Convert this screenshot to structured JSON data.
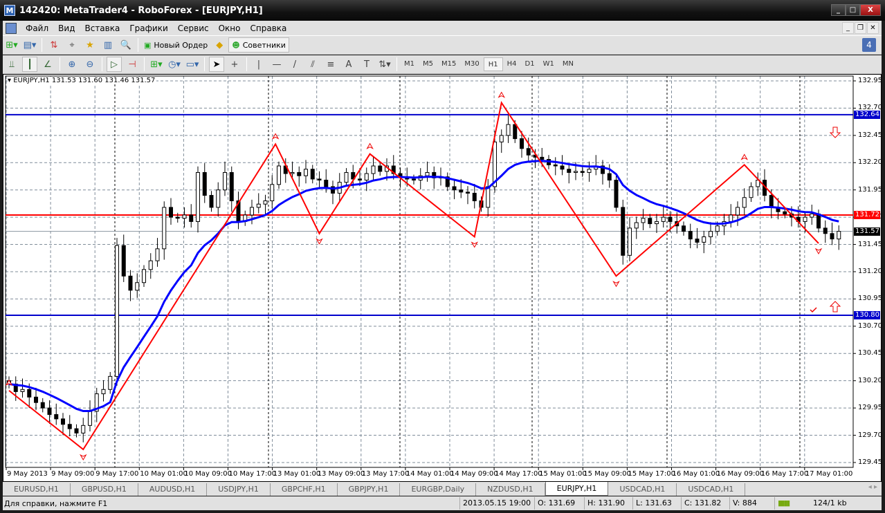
{
  "window": {
    "title": "142420: MetaTrader4 - RoboForex - [EURJPY,H1]",
    "minimize": "_",
    "maximize": "□",
    "close": "X"
  },
  "menu": [
    "Файл",
    "Вид",
    "Вставка",
    "Графики",
    "Сервис",
    "Окно",
    "Справка"
  ],
  "mdi": {
    "minimize": "_",
    "restore": "❐",
    "close": "✕"
  },
  "toolbar": {
    "new_order": "Новый Ордер",
    "experts": "Советники",
    "notifications": "4"
  },
  "timeframes": [
    "M1",
    "M5",
    "M15",
    "M30",
    "H1",
    "H4",
    "D1",
    "W1",
    "MN"
  ],
  "selected_timeframe": "H1",
  "chart_header": "EURJPY,H1  131.53 131.60 131.46 131.57",
  "chart_data": {
    "type": "candlestick",
    "symbol": "EURJPY",
    "timeframe": "H1",
    "ylim": [
      129.4,
      133.05
    ],
    "price_ticks": [
      "132.95",
      "132.70",
      "132.45",
      "132.20",
      "131.95",
      "131.70",
      "131.45",
      "131.20",
      "130.95",
      "130.70",
      "130.45",
      "130.20",
      "129.95",
      "129.70",
      "129.45"
    ],
    "time_ticks": [
      "9 May 2013",
      "9 May 09:00",
      "9 May 17:00",
      "10 May 01:00",
      "10 May 09:00",
      "10 May 17:00",
      "13 May 01:00",
      "13 May 09:00",
      "13 May 17:00",
      "14 May 01:00",
      "14 May 09:00",
      "14 May 17:00",
      "15 May 01:00",
      "15 May 09:00",
      "15 May 17:00",
      "16 May 01:00",
      "16 May 09:00",
      "16 May 17:00",
      "17 May 01:00"
    ],
    "close": [
      130.17,
      130.1,
      130.12,
      130.05,
      130.0,
      129.95,
      129.89,
      129.85,
      129.8,
      129.76,
      129.72,
      129.79,
      129.92,
      130.08,
      130.12,
      130.24,
      131.44,
      131.16,
      131.03,
      131.1,
      131.22,
      131.3,
      131.41,
      131.79,
      131.7,
      131.69,
      131.72,
      131.66,
      132.11,
      131.9,
      131.79,
      131.95,
      132.11,
      131.85,
      131.66,
      131.72,
      131.79,
      131.82,
      131.85,
      132.0,
      132.17,
      132.1,
      132.11,
      132.08,
      132.14,
      132.05,
      132.04,
      131.98,
      131.92,
      132.02,
      132.11,
      132.05,
      132.04,
      132.1,
      132.17,
      132.12,
      132.17,
      132.1,
      132.07,
      132.05,
      132.04,
      132.08,
      132.11,
      132.06,
      132.07,
      131.98,
      131.95,
      131.93,
      131.92,
      131.85,
      131.79,
      131.98,
      132.39,
      132.45,
      132.55,
      132.42,
      132.33,
      132.27,
      132.25,
      132.23,
      132.18,
      132.17,
      132.14,
      132.11,
      132.12,
      132.11,
      132.14,
      132.17,
      132.1,
      132.04,
      131.79,
      131.35,
      131.6,
      131.65,
      131.69,
      131.64,
      131.66,
      131.7,
      131.66,
      131.62,
      131.57,
      131.5,
      131.47,
      131.52,
      131.57,
      131.62,
      131.66,
      131.72,
      131.79,
      131.88,
      131.98,
      132.04,
      131.9,
      131.79,
      131.75,
      131.73,
      131.7,
      131.66,
      131.7,
      131.73,
      131.6,
      131.55,
      131.5,
      131.57
    ],
    "zigzag": [
      [
        0,
        130.11
      ],
      [
        11,
        129.57
      ],
      [
        39.5,
        132.37
      ],
      [
        46,
        131.55
      ],
      [
        53.5,
        132.28
      ],
      [
        69,
        131.52
      ],
      [
        73,
        132.75
      ],
      [
        90,
        131.16
      ],
      [
        109,
        132.18
      ],
      [
        120,
        131.46
      ]
    ],
    "levels": [
      {
        "price": "132.64",
        "color": "#0000cc"
      },
      {
        "price": "131.72",
        "color": "#ff0000"
      },
      {
        "price": "131.57",
        "color": "#000000"
      },
      {
        "price": "130.80",
        "color": "#0000cc"
      }
    ],
    "ma_color": "#0000ff",
    "zigzag_color": "#ff0000"
  },
  "tabs": [
    "EURUSD,H1",
    "GBPUSD,H1",
    "AUDUSD,H1",
    "USDJPY,H1",
    "GBPCHF,H1",
    "GBPJPY,H1",
    "EURGBP,Daily",
    "NZDUSD,H1",
    "EURJPY,H1",
    "USDCAD,H1",
    "USDCAD,H1"
  ],
  "active_tab": "EURJPY,H1",
  "status": {
    "help": "Для справки, нажмите F1",
    "datetime": "2013.05.15 19:00",
    "open": "O: 131.69",
    "high": "H: 131.90",
    "low": "L: 131.63",
    "close": "C: 131.82",
    "volume": "V: 884",
    "traffic": "124/1 kb"
  }
}
